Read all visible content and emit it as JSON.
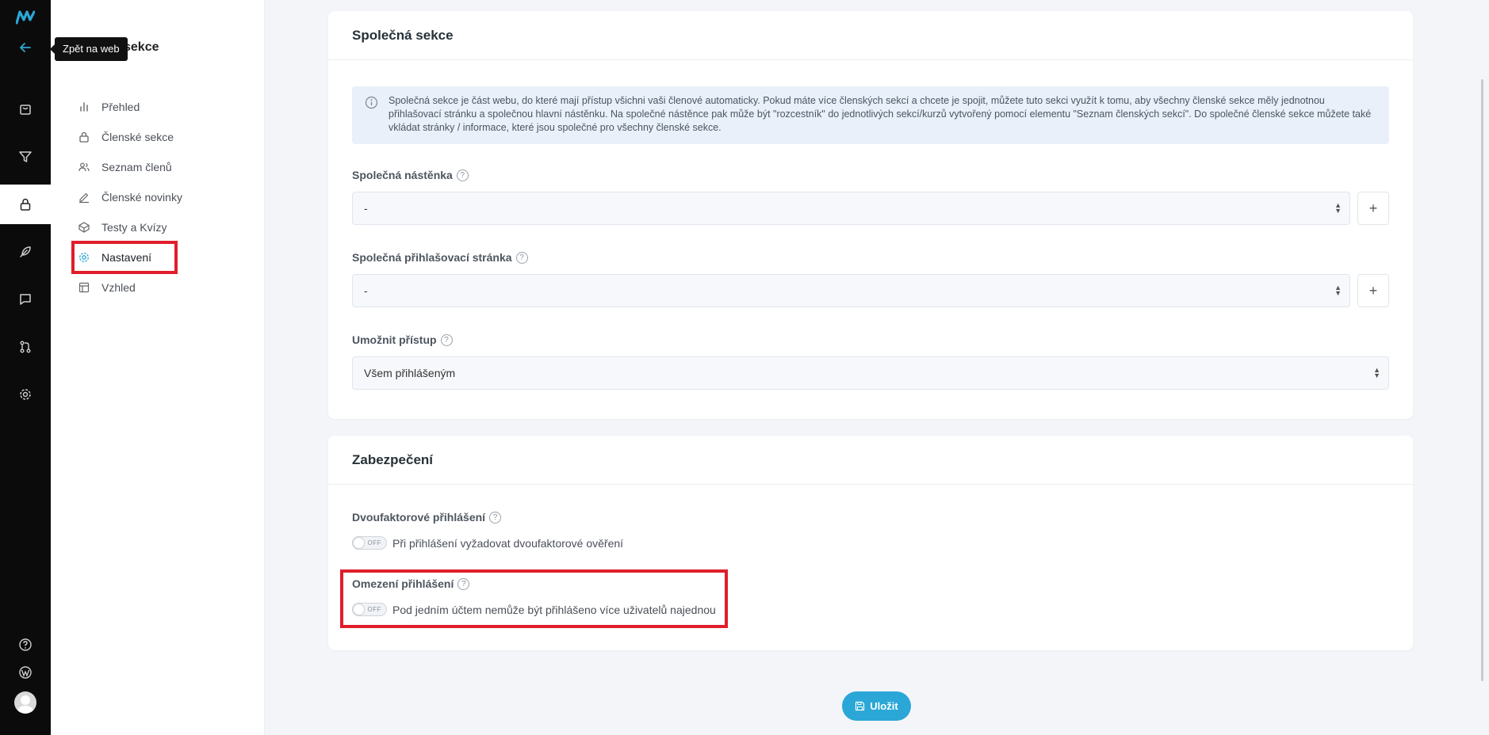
{
  "tooltip": {
    "text": "Zpět na web"
  },
  "sidebar": {
    "title": "sekce",
    "items": [
      {
        "label": "Přehled",
        "icon": "bar-chart-icon"
      },
      {
        "label": "Členské sekce",
        "icon": "lock-icon"
      },
      {
        "label": "Seznam členů",
        "icon": "users-icon"
      },
      {
        "label": "Členské novinky",
        "icon": "pencil-icon"
      },
      {
        "label": "Testy a Kvízy",
        "icon": "quiz-icon"
      },
      {
        "label": "Nastavení",
        "icon": "gear-icon",
        "active": true
      },
      {
        "label": "Vzhled",
        "icon": "layout-icon"
      }
    ]
  },
  "common_section": {
    "title": "Společná sekce",
    "info": "Společná sekce je část webu, do které mají přístup všichni vaši členové automaticky. Pokud máte více členských sekcí a chcete je spojit, můžete tuto sekci využít k tomu, aby všechny členské sekce měly jednotnou přihlašovací stránku a společnou hlavní nástěnku. Na společné nástěnce pak může být \"rozcestník\" do jednotlivých sekcí/kurzů vytvořený pomocí elementu \"Seznam členských sekcí\". Do společné členské sekce můžete také vkládat stránky / informace, které jsou společné pro všechny členské sekce.",
    "dashboard_label": "Společná nástěnka",
    "dashboard_value": "-",
    "login_page_label": "Společná přihlašovací stránka",
    "login_page_value": "-",
    "access_label": "Umožnit přístup",
    "access_value": "Všem přihlášeným",
    "plus": "+",
    "help": "?"
  },
  "security": {
    "title": "Zabezpečení",
    "two_factor_label": "Dvoufaktorové přihlášení",
    "two_factor_text": "Při přihlášení vyžadovat dvoufaktorové ověření",
    "two_factor_state": "OFF",
    "login_limit_label": "Omezení přihlášení",
    "login_limit_text": "Pod jedním účtem nemůže být přihlášeno více uživatelů najednou",
    "login_limit_state": "OFF"
  },
  "save_button": {
    "label": "Uložit"
  },
  "colors": {
    "accent": "#2aa7d6",
    "highlight": "#e01e2b",
    "rail": "#0b0b0b"
  }
}
